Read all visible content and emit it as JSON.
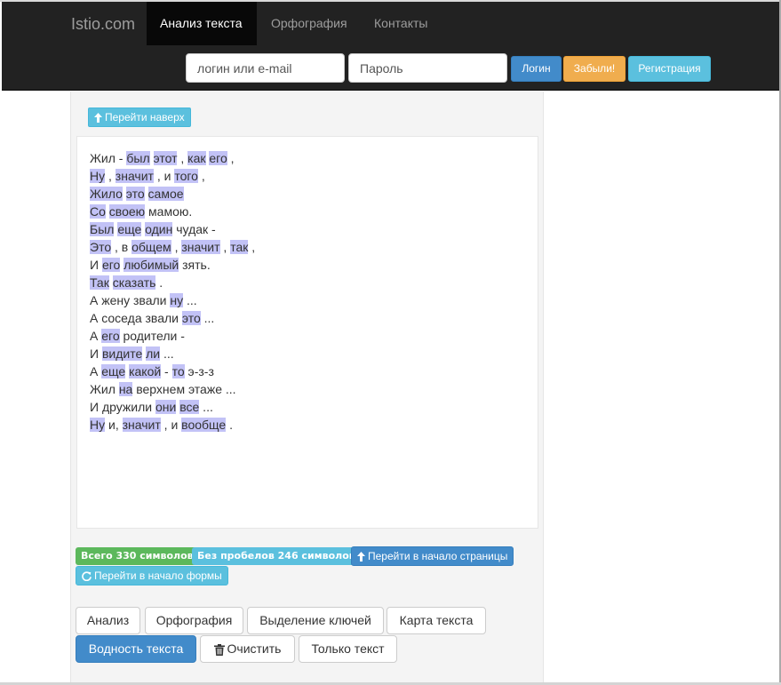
{
  "navbar": {
    "brand": "Istio.com",
    "links": [
      "Анализ текста",
      "Орфография",
      "Контакты"
    ],
    "login_placeholder": "логин или e-mail",
    "password_placeholder": "Пароль",
    "login_button": "Логин",
    "forgot_button": "Забыли!",
    "register_button": "Регистрация"
  },
  "top_button": "Перейти наверх",
  "text_lines": [
    [
      {
        "t": "Жил - "
      },
      {
        "t": "был",
        "h": true
      },
      {
        "t": " "
      },
      {
        "t": "этот",
        "h": true
      },
      {
        "t": " , "
      },
      {
        "t": "как",
        "h": true
      },
      {
        "t": " "
      },
      {
        "t": "его",
        "h": true
      },
      {
        "t": " ,"
      }
    ],
    [
      {
        "t": "Ну",
        "h": true
      },
      {
        "t": " , "
      },
      {
        "t": "значит",
        "h": true
      },
      {
        "t": " , и "
      },
      {
        "t": "того",
        "h": true
      },
      {
        "t": " ,"
      }
    ],
    [
      {
        "t": "Жило",
        "h": true
      },
      {
        "t": " "
      },
      {
        "t": "это",
        "h": true
      },
      {
        "t": " "
      },
      {
        "t": "самое",
        "h": true
      }
    ],
    [
      {
        "t": "Со",
        "h": true
      },
      {
        "t": " "
      },
      {
        "t": "своею",
        "h": true
      },
      {
        "t": " мамою."
      }
    ],
    [
      {
        "t": "Был",
        "h": true
      },
      {
        "t": " "
      },
      {
        "t": "еще",
        "h": true
      },
      {
        "t": " "
      },
      {
        "t": "один",
        "h": true
      },
      {
        "t": " чудак -"
      }
    ],
    [
      {
        "t": "Это",
        "h": true
      },
      {
        "t": " , в "
      },
      {
        "t": "общем",
        "h": true
      },
      {
        "t": " , "
      },
      {
        "t": "значит",
        "h": true
      },
      {
        "t": " , "
      },
      {
        "t": "так",
        "h": true
      },
      {
        "t": " ,"
      }
    ],
    [
      {
        "t": "И "
      },
      {
        "t": "его",
        "h": true
      },
      {
        "t": " "
      },
      {
        "t": "любимый",
        "h": true
      },
      {
        "t": " зять."
      }
    ],
    [
      {
        "t": "Так",
        "h": true
      },
      {
        "t": " "
      },
      {
        "t": "сказать",
        "h": true
      },
      {
        "t": " ."
      }
    ],
    [
      {
        "t": "А жену звали "
      },
      {
        "t": "ну",
        "h": true
      },
      {
        "t": " ..."
      }
    ],
    [
      {
        "t": "А соседа звали "
      },
      {
        "t": "это",
        "h": true
      },
      {
        "t": " ..."
      }
    ],
    [
      {
        "t": "А "
      },
      {
        "t": "его",
        "h": true
      },
      {
        "t": " родители -"
      }
    ],
    [
      {
        "t": "И "
      },
      {
        "t": "видите",
        "h": true
      },
      {
        "t": " "
      },
      {
        "t": "ли",
        "h": true
      },
      {
        "t": " ..."
      }
    ],
    [
      {
        "t": "А "
      },
      {
        "t": "еще",
        "h": true
      },
      {
        "t": " "
      },
      {
        "t": "какой",
        "h": true
      },
      {
        "t": " - "
      },
      {
        "t": "то",
        "h": true
      },
      {
        "t": " э-з-з"
      }
    ],
    [
      {
        "t": "Жил "
      },
      {
        "t": "на",
        "h": true
      },
      {
        "t": " верхнем этаже ..."
      }
    ],
    [
      {
        "t": "И дружили "
      },
      {
        "t": "они",
        "h": true
      },
      {
        "t": " "
      },
      {
        "t": "все",
        "h": true
      },
      {
        "t": " ..."
      }
    ],
    [
      {
        "t": "Ну",
        "h": true
      },
      {
        "t": " и, "
      },
      {
        "t": "значит",
        "h": true
      },
      {
        "t": " , и "
      },
      {
        "t": "вообще",
        "h": true
      },
      {
        "t": " ."
      }
    ]
  ],
  "stats": {
    "total_label": "Всего 330 символов.",
    "nospace_label": "Без пробелов 246 символов."
  },
  "page_start_button": "Перейти в начало страницы",
  "form_start_button": "Перейти в начало формы",
  "tools": {
    "analysis": "Анализ",
    "spelling": "Орфография",
    "keywords": "Выделение ключей",
    "textmap": "Карта текста",
    "water": "Водность текста",
    "clear": "Очистить",
    "textonly": "Только текст"
  },
  "colors": {
    "navbar_bg": "#222222",
    "highlight": "#c2c2f6",
    "primary": "#428bca",
    "info": "#5bc0de",
    "success": "#5cb85c",
    "warning": "#f0ad4e"
  },
  "icons": [
    "arrow-up-icon",
    "refresh-icon",
    "trash-icon"
  ]
}
